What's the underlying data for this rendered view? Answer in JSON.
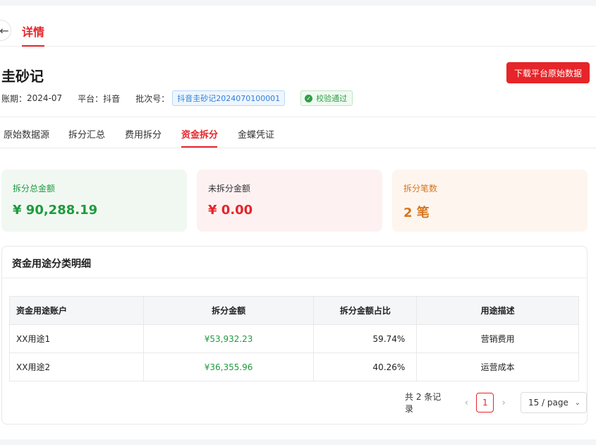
{
  "header": {
    "back_glyph": "←",
    "tab_label": "详情"
  },
  "record": {
    "title": "圭砂记",
    "download_label": "下载平台原始数据",
    "period_label": "账期：",
    "period_value": "2024-07",
    "platform_label": "平台：",
    "platform_value": "抖音",
    "batch_label": "批次号：",
    "batch_value": "抖音圭砂记2024070100001",
    "verify_label": "校验通过"
  },
  "tabs": [
    {
      "label": "原始数据源",
      "active": false
    },
    {
      "label": "拆分汇总",
      "active": false
    },
    {
      "label": "费用拆分",
      "active": false
    },
    {
      "label": "资金拆分",
      "active": true
    },
    {
      "label": "金蝶凭证",
      "active": false
    }
  ],
  "stats": {
    "total_label": "拆分总金额",
    "total_value": "¥ 90,288.19",
    "unsplit_label": "未拆分金额",
    "unsplit_value": "¥ 0.00",
    "count_label": "拆分笔数",
    "count_value": "2 笔"
  },
  "detail": {
    "title": "资金用途分类明细",
    "columns": [
      "资金用途账户",
      "拆分金额",
      "拆分金额占比",
      "用途描述"
    ],
    "rows": [
      {
        "account": "XX用途1",
        "amount": "¥53,932.23",
        "ratio": "59.74%",
        "desc": "营销费用"
      },
      {
        "account": "XX用途2",
        "amount": "¥36,355.96",
        "ratio": "40.26%",
        "desc": "运营成本"
      }
    ]
  },
  "pagination": {
    "total_text": "共 2 条记录",
    "prev_glyph": "‹",
    "next_glyph": "›",
    "current_page": "1",
    "page_size": "15 / page",
    "size_chevron": "⌄"
  },
  "colors": {
    "accent": "#e5252a",
    "success": "#1f9a3e",
    "warning": "#d6761e"
  }
}
